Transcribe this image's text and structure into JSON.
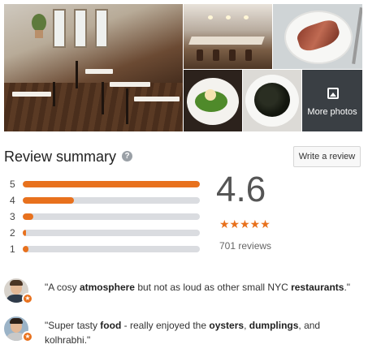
{
  "photos": {
    "more_label": "More photos"
  },
  "summary": {
    "title": "Review summary",
    "help_symbol": "?",
    "write_review_label": "Write a review",
    "average": "4.6",
    "stars": "★★★★★",
    "review_count": "701 reviews",
    "distribution": [
      {
        "stars": "5",
        "fraction": 1.0
      },
      {
        "stars": "4",
        "fraction": 0.29
      },
      {
        "stars": "3",
        "fraction": 0.06
      },
      {
        "stars": "2",
        "fraction": 0.015
      },
      {
        "stars": "1",
        "fraction": 0.03
      }
    ]
  },
  "snippets": [
    {
      "parts": [
        {
          "text": "\"A cosy ",
          "bold": false
        },
        {
          "text": "atmosphere",
          "bold": true
        },
        {
          "text": " but not as loud as other small NYC ",
          "bold": false
        },
        {
          "text": "restaurants",
          "bold": true
        },
        {
          "text": ".\"",
          "bold": false
        }
      ]
    },
    {
      "parts": [
        {
          "text": "\"Super tasty ",
          "bold": false
        },
        {
          "text": "food",
          "bold": true
        },
        {
          "text": " - really enjoyed the ",
          "bold": false
        },
        {
          "text": "oysters",
          "bold": true
        },
        {
          "text": ", ",
          "bold": false
        },
        {
          "text": "dumplings",
          "bold": true
        },
        {
          "text": ", and kolhrabhi.\"",
          "bold": false
        }
      ]
    }
  ],
  "colors": {
    "accent": "#e8711d",
    "track": "#dadce0"
  }
}
